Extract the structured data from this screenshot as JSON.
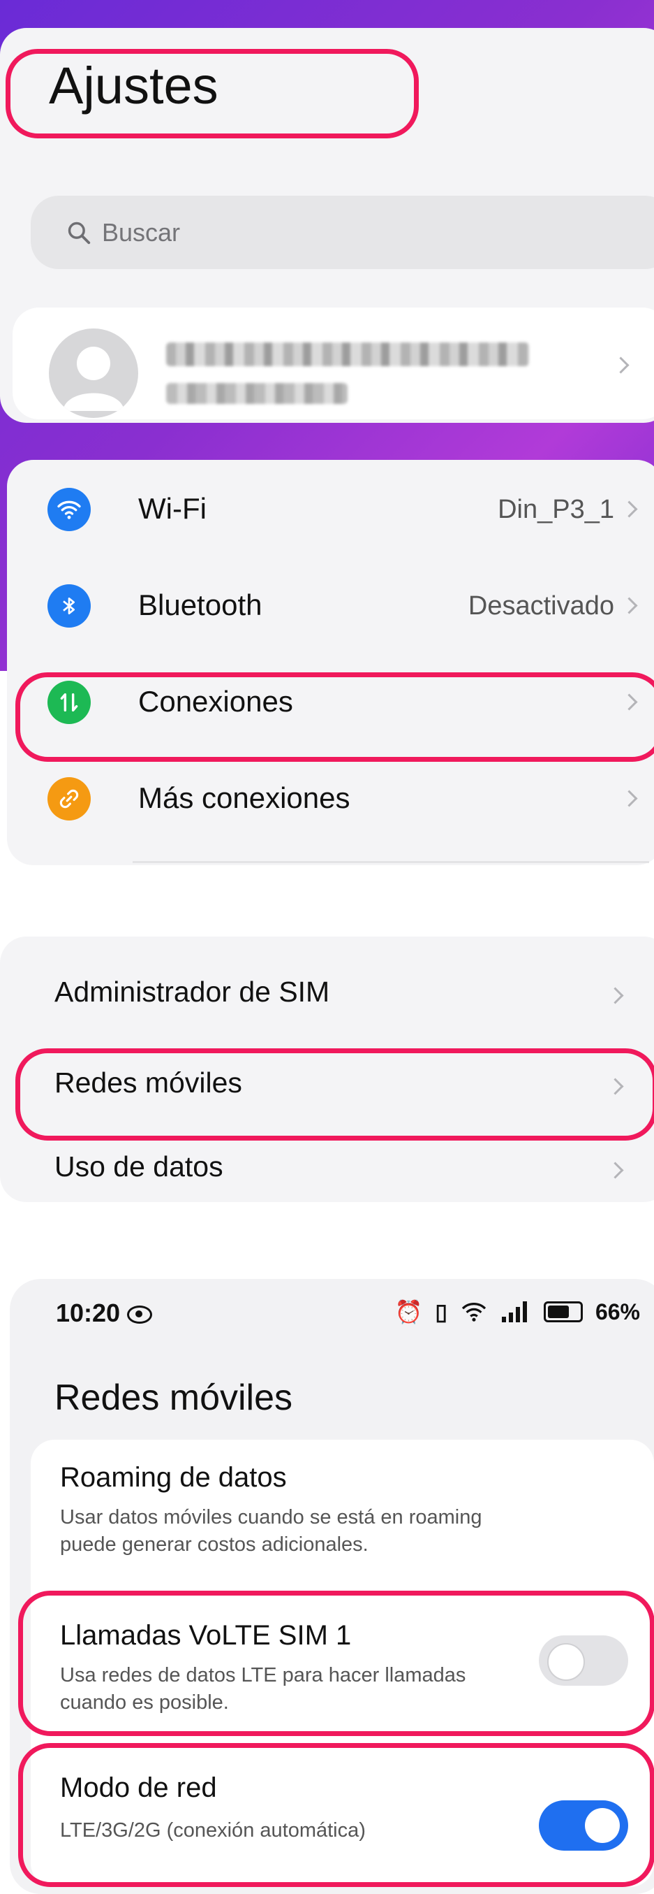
{
  "settings": {
    "title": "Ajustes",
    "search": {
      "placeholder": "Buscar"
    },
    "account": {
      "chevron": "chevron-right-icon"
    },
    "connectivity": [
      {
        "label": "Wi-Fi",
        "value": "Din_P3_1",
        "icon": "wifi-icon",
        "color": "#1f7cf2"
      },
      {
        "label": "Bluetooth",
        "value": "Desactivado",
        "icon": "bluetooth-icon",
        "color": "#1f7cf2"
      },
      {
        "label": "Conexiones",
        "value": "",
        "icon": "data-transfer-icon",
        "color": "#1db954"
      },
      {
        "label": "Más conexiones",
        "value": "",
        "icon": "link-icon",
        "color": "#f59a12"
      }
    ],
    "sim_section": [
      {
        "label": "Administrador de SIM"
      },
      {
        "label": "Redes móviles"
      },
      {
        "label": "Uso de datos"
      }
    ]
  },
  "mobile_networks": {
    "status_bar": {
      "time": "10:20",
      "battery": "66%"
    },
    "title": "Redes móviles",
    "items": [
      {
        "title": "Roaming de datos",
        "desc": "Usar datos móviles cuando se está en roaming puede generar costos adicionales."
      },
      {
        "title": "Llamadas VoLTE SIM 1",
        "desc": "Usa redes de datos LTE para hacer llamadas cuando es posible.",
        "toggle_on": false
      },
      {
        "title": "Modo de red",
        "desc": "LTE/3G/2G (conexión automática)",
        "toggle_on": true
      }
    ]
  },
  "colors": {
    "highlight": "#f0195c",
    "toggle_on": "#1f6ff0",
    "toggle_off": "#e3e3e6"
  }
}
